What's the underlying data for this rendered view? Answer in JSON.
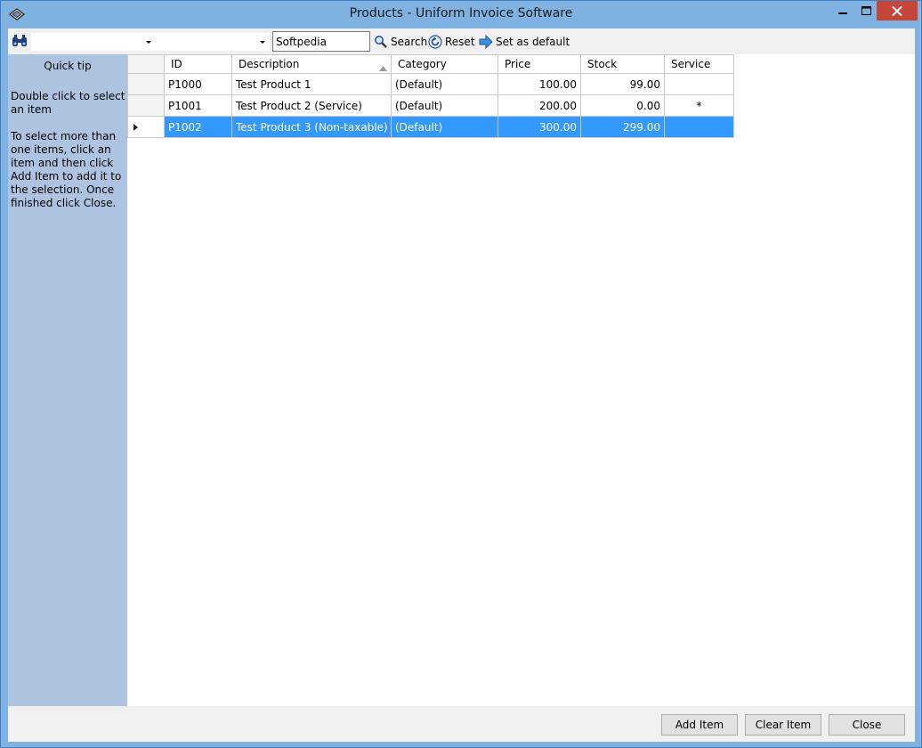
{
  "window": {
    "title": "Products - Uniform Invoice Software"
  },
  "toolbar": {
    "combo1_value": "",
    "combo2_value": "",
    "search_value": "Softpedia",
    "search_label": "Search",
    "reset_label": "Reset",
    "default_label": "Set as default"
  },
  "sidebar": {
    "title": "Quick tip",
    "tip1": "Double click to select an item",
    "tip2": "To select more than one items, click an item and then click Add Item to add it to the selection. Once finished click Close."
  },
  "grid": {
    "columns": [
      "ID",
      "Description",
      "Category",
      "Price",
      "Stock",
      "Service"
    ],
    "rows": [
      {
        "id": "P1000",
        "description": "Test Product 1",
        "category": "(Default)",
        "price": "100.00",
        "stock": "99.00",
        "service": ""
      },
      {
        "id": "P1001",
        "description": "Test Product 2 (Service)",
        "category": "(Default)",
        "price": "200.00",
        "stock": "0.00",
        "service": "*"
      },
      {
        "id": "P1002",
        "description": "Test Product 3 (Non-taxable)",
        "category": "(Default)",
        "price": "300.00",
        "stock": "299.00",
        "service": ""
      }
    ],
    "selected_row": 2
  },
  "footer": {
    "add_label": "Add Item",
    "clear_label": "Clear Item",
    "close_label": "Close"
  },
  "colors": {
    "titlebar": "#7fb2e0",
    "sidebar": "#adc3e0",
    "selection": "#3399ff",
    "close_button": "#c7463a"
  }
}
